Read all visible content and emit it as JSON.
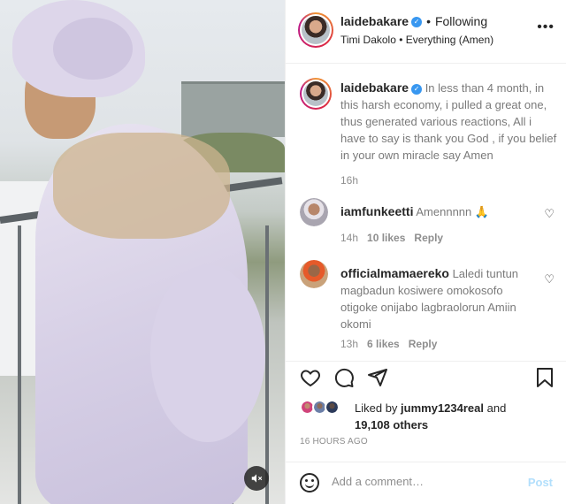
{
  "post": {
    "author": "laidebakare",
    "follow_status": "Following",
    "audio_line": "Timi Dakolo • Everything (Amen)",
    "more_icon": "more-horizontal-icon",
    "mute_icon": "volume-muted-icon"
  },
  "caption": {
    "username": "laidebakare",
    "text": "In less than 4 month, in this harsh economy, i pulled a great one, thus generated various reactions, All i have to say is thank you God , if you belief in your own miracle say Amen",
    "time": "16h"
  },
  "comments": [
    {
      "username": "iamfunkeetti",
      "text": "Amennnnn 🙏",
      "time": "14h",
      "likes": "10 likes",
      "reply": "Reply"
    },
    {
      "username": "officialmamaereko",
      "text": "Laledi tuntun magbadun kosiwere omokosofo otigoke onijabo lagbraolorun Amiin okomi",
      "time": "13h",
      "likes": "6 likes",
      "reply": "Reply"
    }
  ],
  "actions": {
    "like_icon": "heart-icon",
    "comment_icon": "comment-icon",
    "share_icon": "share-icon",
    "save_icon": "bookmark-icon"
  },
  "likes_summary": {
    "prefix": "Liked by",
    "user": "jummy1234real",
    "and": "and",
    "count": "19,108 others"
  },
  "timestamp": "16 HOURS AGO",
  "add_comment": {
    "placeholder": "Add a comment…",
    "post_label": "Post",
    "emoji_icon": "emoji-icon"
  },
  "colors": {
    "verified": "#3897f0",
    "post_button_disabled": "#b2dffc",
    "muted_text": "#8e8e8e"
  }
}
